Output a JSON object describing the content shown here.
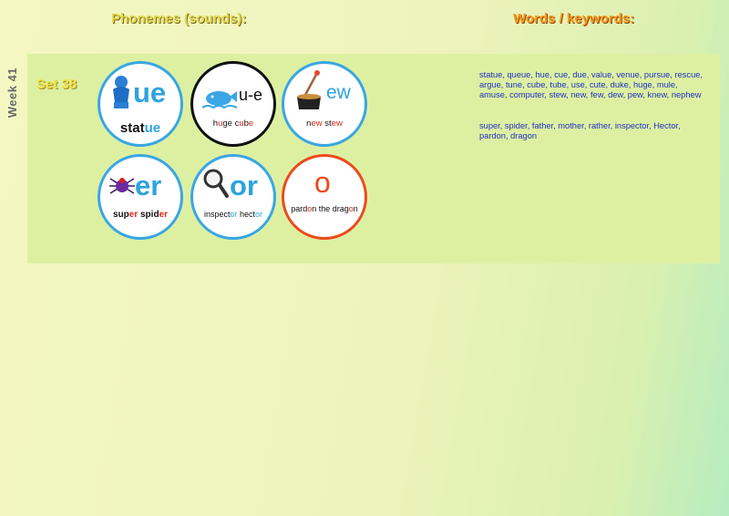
{
  "headers": {
    "phonemes": "Phonemes (sounds):",
    "words": "Words / keywords:"
  },
  "week_label": "Week 41",
  "set_label": "Set 38",
  "badges": [
    {
      "grapheme": "ue",
      "caption": [
        "stat",
        "ue"
      ],
      "icon": "statue-icon"
    },
    {
      "grapheme": "u-e",
      "caption": [
        "h",
        "u",
        "ge c",
        "u",
        "b",
        "e"
      ],
      "icon": "whale-icon"
    },
    {
      "grapheme": "ew",
      "caption": [
        "n",
        "ew",
        " st",
        "ew"
      ],
      "icon": "stew-pot-icon"
    },
    {
      "grapheme": "er",
      "caption": [
        "sup",
        "er",
        " spid",
        "er"
      ],
      "icon": "spider-icon"
    },
    {
      "grapheme": "or",
      "caption": [
        "inspect",
        "or",
        " hect",
        "or"
      ],
      "icon": "magnifying-glass-icon"
    },
    {
      "grapheme": "o",
      "caption": [
        "pard",
        "o",
        "n the drag",
        "o",
        "n"
      ]
    }
  ],
  "words": {
    "line1": "statue, queue, hue, cue, due, value, venue, pursue, rescue, argue, tune, cube, tube, use, cute, duke, huge, mule, amuse, computer, stew, new, few, dew, pew, knew, nephew",
    "line2": "super, spider, father, mother, rather, inspector, Hector, pardon, dragon"
  },
  "colors": {
    "accent_blue": "#2da3df",
    "accent_red": "#e1271a",
    "words": "#2030c0"
  }
}
